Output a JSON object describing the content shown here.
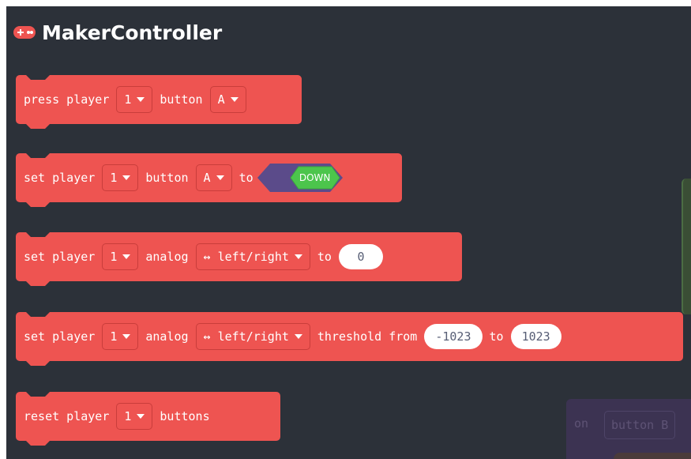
{
  "category": {
    "title": "MakerController",
    "icon": "gamepad-icon",
    "color": "#ee5451"
  },
  "blocks": [
    {
      "press_label": "press player",
      "player_value": "1",
      "button_label": "button",
      "button_value": "A"
    },
    {
      "set_label": "set player",
      "player_value": "1",
      "button_label": "button",
      "button_value": "A",
      "to_label": "to",
      "state_value": "DOWN"
    },
    {
      "set_label": "set player",
      "player_value": "1",
      "analog_label": "analog",
      "axis_value": "↔ left/right",
      "to_label": "to",
      "value": "0"
    },
    {
      "set_label": "set player",
      "player_value": "1",
      "analog_label": "analog",
      "axis_value": "↔ left/right",
      "threshold_label": "threshold from",
      "min_value": "-1023",
      "to_label": "to",
      "max_value": "1023"
    },
    {
      "reset_label": "reset player",
      "player_value": "1",
      "buttons_label": "buttons"
    }
  ],
  "background_block": {
    "on_label": "on",
    "button_value": "button B"
  }
}
